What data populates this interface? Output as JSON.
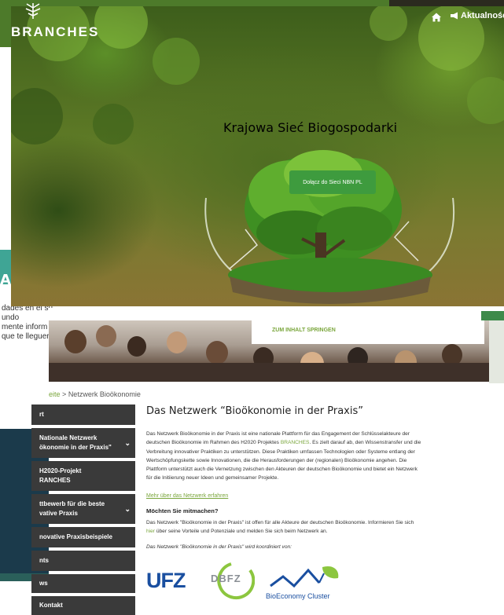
{
  "branches": {
    "brand": "BRANCHES",
    "nav": {
      "news_label": "Aktualności"
    }
  },
  "hero": {
    "title": "Krajowa Sieć Biogospodarki",
    "button_label": "Dołącz do Sieci NBN PL"
  },
  "spanish_card": {
    "heading": "A LA RI",
    "lines": [
      "dades en el su",
      "undo",
      "mente inform",
      "que te lleguer"
    ]
  },
  "site": {
    "skip_link": "ZUM INHALT SPRINGEN",
    "breadcrumb": {
      "home": "eite",
      "separator": ">",
      "current": "Netzwerk Bioökonomie"
    },
    "sidebar": [
      {
        "label": "rt",
        "chevron": false
      },
      {
        "label": "Nationale Netzwerk\nökonomie in der Praxis\"",
        "chevron": true
      },
      {
        "label": "H2020-Projekt\nRANCHES",
        "chevron": false
      },
      {
        "label": "ttbewerb für die beste\nvative Praxis",
        "chevron": true
      },
      {
        "label": "novative Praxisbeispiele",
        "chevron": false
      },
      {
        "label": "nts",
        "chevron": false
      },
      {
        "label": "ws",
        "chevron": false
      },
      {
        "label": "Kontakt",
        "chevron": false
      }
    ],
    "title": "Das Netzwerk “Bioökonomie in der Praxis”",
    "intro_lines": [
      "Das Netzwerk Bioökonomie in der Praxis ist eine nationale Plattform für das Engagement der Schlüsselakteure der",
      "deutschen Bioökonomie im Rahmen des H2020 Projektes ",
      "BRANCHES",
      ". Es zielt darauf ab, den Wissenstransfer und die",
      "Verbreitung innovativer Praktiken zu unterstützen. Diese Praktiken umfassen Technologien oder Systeme entlang der",
      "Wertschöpfungskette sowie Innovationen, die die Herausforderungen der (regionalen) Bioökonomie angehen. Die",
      "Plattform unterstützt auch die Vernetzung zwischen den Akteuren der deutschen Bioökonomie und bietet ein Netzwerk",
      "für die Initiierung neuer Ideen und gemeinsamer Projekte."
    ],
    "more_link": "Mehr über das Netzwerk erfahren",
    "join_heading": "Möchten Sie mitmachen?",
    "join_lines": [
      "Das Netzwerk \"Bioökonomie in der Praxis\" ist offen für alle Akteure der deutschen Bioökonomie. Informieren Sie sich",
      "hier",
      " über seine Vorteile und Potenziale und melden Sie sich beim Netzwerk an."
    ],
    "coordinated_by": "Das Netzwerk \"Bioökonomie in der Praxis\" wird koordiniert von:",
    "logos": {
      "ufz": "UFZ",
      "dbfz": "DBFZ",
      "bioeconomy": "BioEconomy Cluster"
    }
  },
  "colors": {
    "accent_green": "#7aa63c",
    "teal": "#3fa595",
    "sidebar_bg": "#3a3a3a",
    "button_green": "#3e9b3e"
  }
}
